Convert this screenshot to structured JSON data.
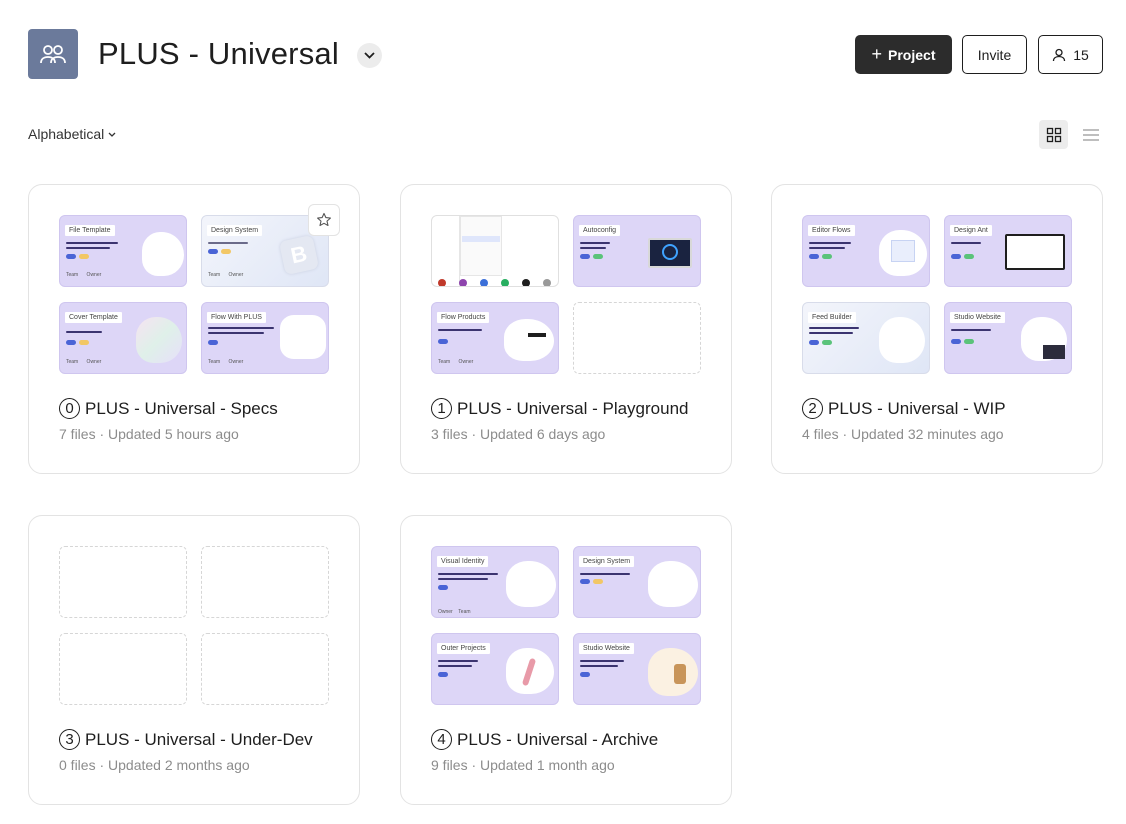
{
  "header": {
    "team_name": "PLUS - Universal",
    "project_button": "Project",
    "invite_button": "Invite",
    "members_count": "15"
  },
  "toolbar": {
    "sort_label": "Alphabetical"
  },
  "projects": [
    {
      "number": "0",
      "title": "PLUS - Universal - Specs",
      "meta": "7 files · Updated 5 hours ago",
      "thumbnails": [
        "File Template",
        "Design System",
        "Cover Template",
        "Flow With PLUS"
      ]
    },
    {
      "number": "1",
      "title": "PLUS - Universal - Playground",
      "meta": "3 files · Updated 6 days ago",
      "thumbnails": [
        "",
        "Autoconfig",
        "Flow Products",
        ""
      ]
    },
    {
      "number": "2",
      "title": "PLUS - Universal - WIP",
      "meta": "4 files · Updated 32 minutes ago",
      "thumbnails": [
        "Editor Flows",
        "Design Ant",
        "Feed Builder",
        "Studio Website"
      ]
    },
    {
      "number": "3",
      "title": "PLUS - Universal - Under-Dev",
      "meta": "0 files · Updated 2 months ago",
      "thumbnails": [
        "",
        "",
        "",
        ""
      ]
    },
    {
      "number": "4",
      "title": "PLUS - Universal - Archive",
      "meta": "9 files · Updated 1 month ago",
      "thumbnails": [
        "Visual Identity",
        "Design System",
        "Outer Projects",
        "Studio Website"
      ]
    }
  ],
  "colors": {
    "primary_button": "#2c2c2c",
    "team_avatar": "#6b7a9b",
    "thumbnail_purple": "#ddd6f7"
  }
}
